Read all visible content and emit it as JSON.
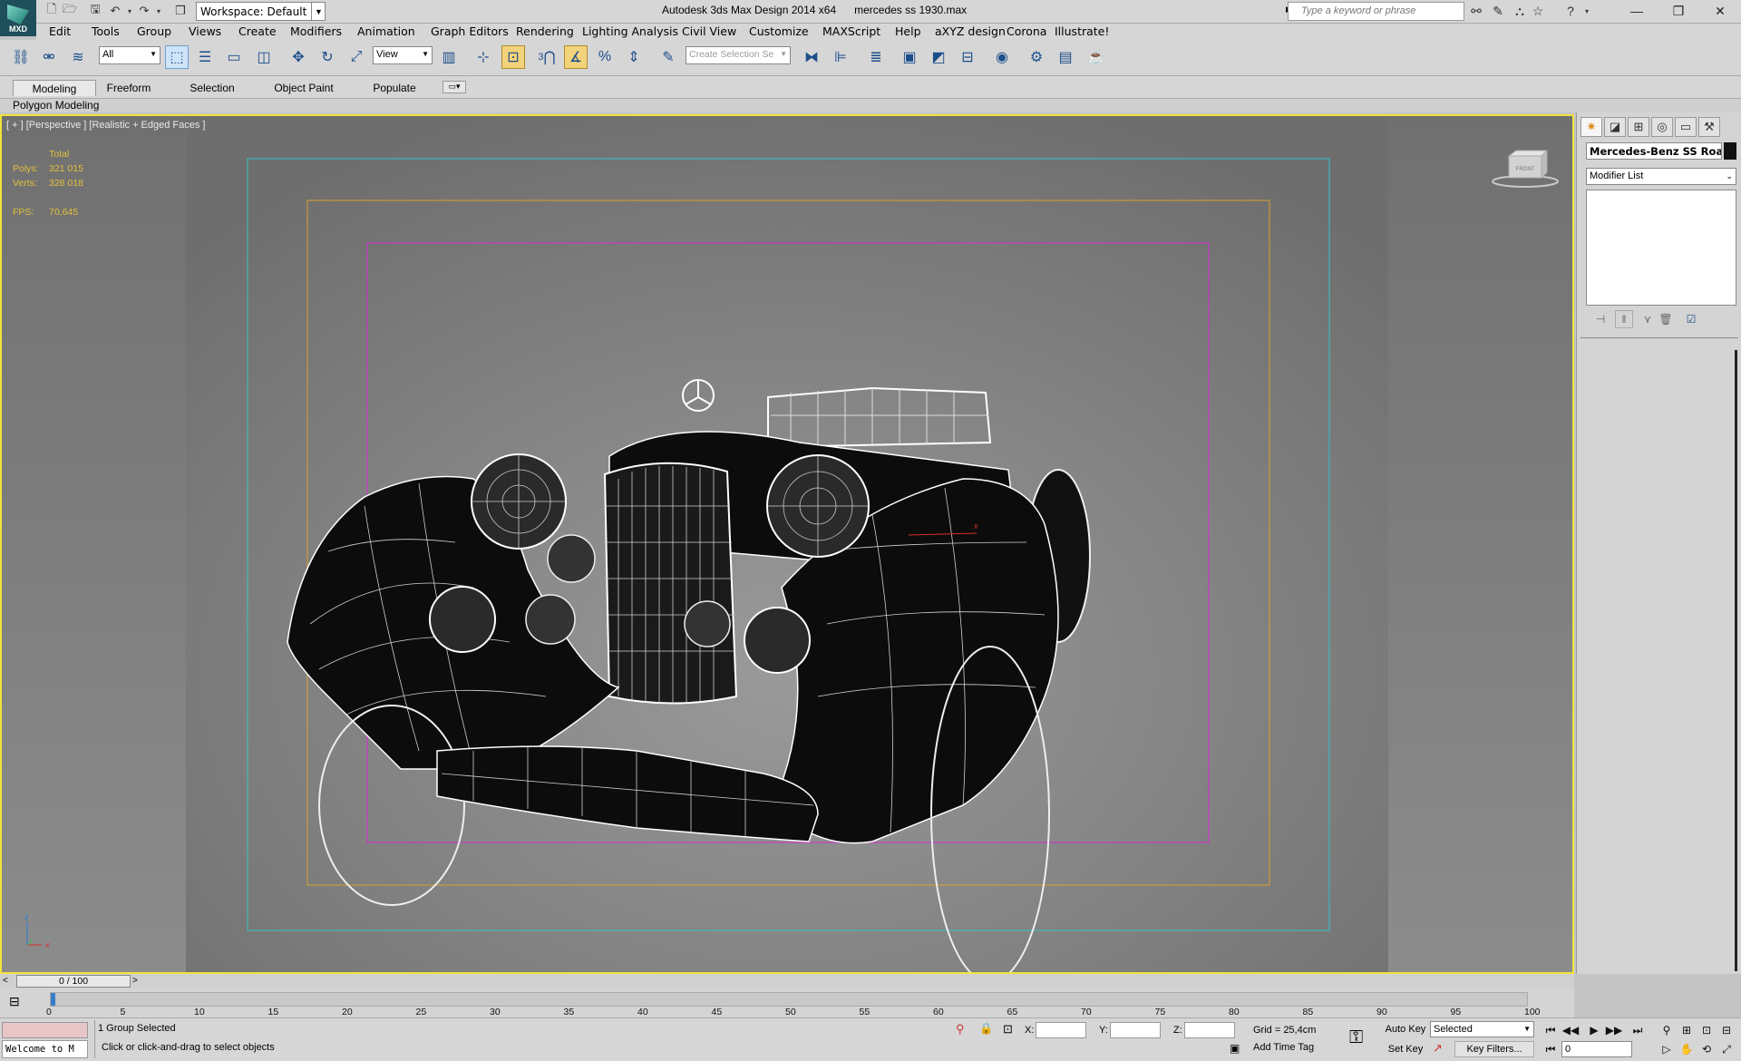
{
  "app": {
    "logo_text": "MXD",
    "workspace": "Workspace: Default",
    "title": "Autodesk 3ds Max Design 2014 x64      mercedes ss 1930.max",
    "search_placeholder": "Type a keyword or phrase"
  },
  "menu": [
    "Edit",
    "Tools",
    "Group",
    "Views",
    "Create",
    "Modifiers",
    "Animation",
    "Graph Editors",
    "Rendering",
    "Lighting Analysis",
    "Civil View",
    "Customize",
    "MAXScript",
    "Help",
    "aXYZ design",
    "Corona",
    "Illustrate!"
  ],
  "toolbar": {
    "selection_filter": "All",
    "ref_coord": "View",
    "selection_set_placeholder": "Create Selection Se",
    "snap_label": "3"
  },
  "ribbon": {
    "tabs": [
      "Modeling",
      "Freeform",
      "Selection",
      "Object Paint",
      "Populate"
    ],
    "active_tab": "Modeling",
    "panel_label": "Polygon Modeling"
  },
  "viewport": {
    "label": "[ + ] [Perspective ] [Realistic + Edged Faces ]",
    "stats": {
      "total_label": "Total",
      "polys_label": "Polys:",
      "polys": "321 015",
      "verts_label": "Verts:",
      "verts": "328 018",
      "fps_label": "FPS:",
      "fps": "70,645"
    },
    "viewcube_label": "FRONT",
    "border_color": "#f1e339",
    "stats_color": "#e2c03b"
  },
  "command_panel": {
    "object_name": "Mercedes-Benz SS Roadster",
    "modifier_list": "Modifier List"
  },
  "timeline": {
    "frame_slider": "0 / 100",
    "ticks": [
      "0",
      "5",
      "10",
      "15",
      "20",
      "25",
      "30",
      "35",
      "40",
      "45",
      "50",
      "55",
      "60",
      "65",
      "70",
      "75",
      "80",
      "85",
      "90",
      "95",
      "100"
    ]
  },
  "status": {
    "maxscript": "Welcome to M",
    "selection": "1 Group Selected",
    "prompt": "Click or click-and-drag to select objects",
    "x_label": "X:",
    "y_label": "Y:",
    "z_label": "Z:",
    "grid": "Grid = 25,4cm",
    "add_time_tag": "Add Time Tag",
    "auto_key": "Auto Key",
    "set_key": "Set Key",
    "key_mode": "Selected",
    "key_filters": "Key Filters...",
    "current_frame": "0"
  }
}
